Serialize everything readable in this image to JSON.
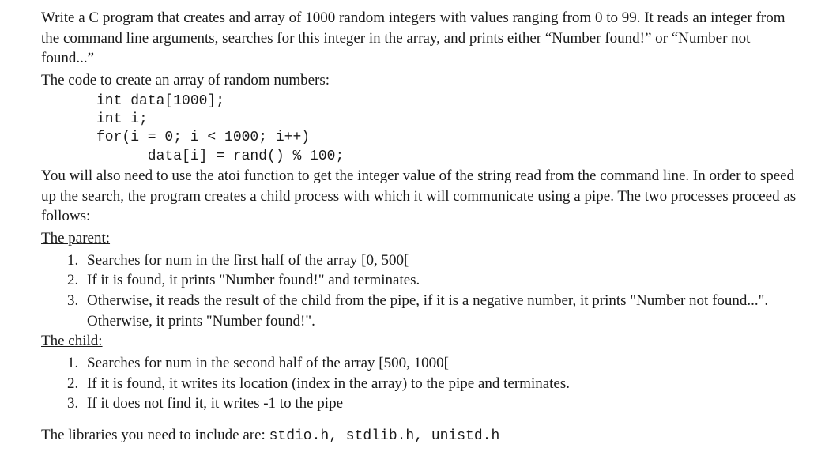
{
  "intro": {
    "p1": "Write a C program that creates and array of 1000 random integers with values ranging from 0 to 99. It reads an integer from the command line arguments, searches for this integer in the array, and prints either “Number found!” or “Number not found...”",
    "p2": "The code to create an array of random numbers:"
  },
  "code": {
    "l1": "int data[1000];",
    "l2": "int i;",
    "l3": "for(i = 0; i < 1000; i++)",
    "l4": "      data[i] = rand() % 100;"
  },
  "mid": {
    "p1": "You will also need to use the atoi function to get the integer value of the string read from the command line. In order to speed up the search, the program creates a child process with which it will communicate using a pipe. The two processes proceed as follows:"
  },
  "parent": {
    "heading": "The parent:",
    "items": [
      "Searches for num in the first half of the array [0, 500[",
      "If it is found, it prints \"Number found!\" and terminates.",
      "Otherwise, it reads the result of the child from the pipe, if it is a negative number, it prints \"Number not found...\". Otherwise, it prints \"Number found!\"."
    ]
  },
  "child": {
    "heading": "The child:",
    "items": [
      "Searches for num in the second half of the array [500, 1000[",
      "If it is found, it writes its location (index in the array) to the pipe and terminates.",
      "If it does not find it, it writes -1 to the pipe"
    ]
  },
  "libs": {
    "prefix": "The libraries you need to include are: ",
    "code": "stdio.h, stdlib.h, unistd.h"
  }
}
